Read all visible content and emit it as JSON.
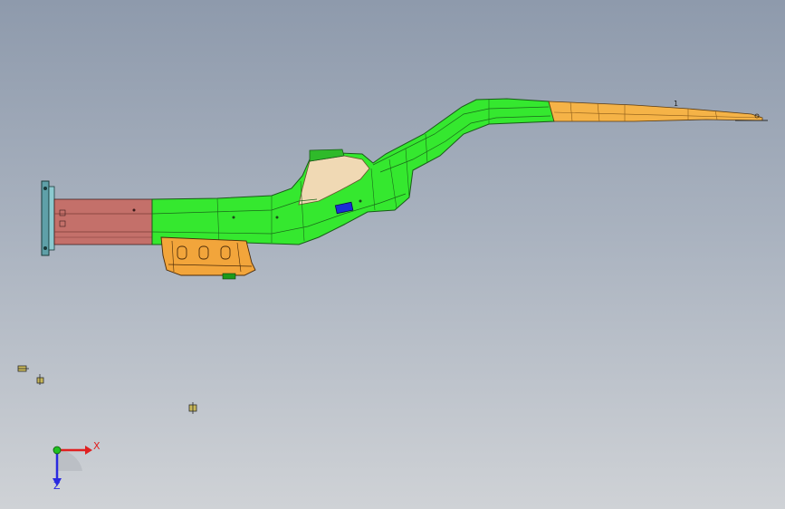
{
  "viewport": {
    "background_top": "#8e9aac",
    "background_bottom": "#cfd2d6"
  },
  "model": {
    "colors": {
      "rail_green": "#35e82f",
      "rail_dark_green": "#1d9a1a",
      "rail_tan": "#f0d9b4",
      "bracket_orange": "#f2a53b",
      "front_red": "#c4706a",
      "rear_orange": "#f5b347",
      "marker_blue": "#1a2ed6",
      "edge_line": "#1a3a1a"
    },
    "part_number": "1"
  },
  "triad": {
    "x_label": "X",
    "y_label": "Z",
    "x_color": "#e02020",
    "z_color": "#2a2ae0",
    "origin_color": "#20c020"
  }
}
